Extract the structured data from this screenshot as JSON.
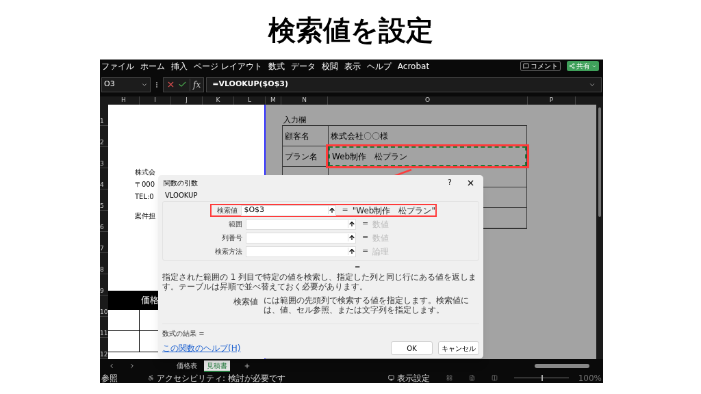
{
  "title": "検索値を設定",
  "menu": [
    {
      "label": "ファイル"
    },
    {
      "label": "ホーム"
    },
    {
      "label": "挿入"
    },
    {
      "label": "ページ レイアウト"
    },
    {
      "label": "数式"
    },
    {
      "label": "データ"
    },
    {
      "label": "校閲"
    },
    {
      "label": "表示"
    },
    {
      "label": "ヘルプ"
    },
    {
      "label": "Acrobat"
    }
  ],
  "comment_button": "コメント",
  "share_button": "共有",
  "name_box": "O3",
  "function_button": "fx",
  "formula": "=VLOOKUP($O$3)",
  "columns": [
    {
      "label": "H",
      "kind": "page"
    },
    {
      "label": "I",
      "kind": "page"
    },
    {
      "label": "J",
      "kind": "page"
    },
    {
      "label": "K",
      "kind": "page"
    },
    {
      "label": "L",
      "kind": "page"
    },
    {
      "label": "M",
      "kind": "m"
    },
    {
      "label": "N",
      "kind": "n"
    },
    {
      "label": "O",
      "kind": "o"
    },
    {
      "label": "P",
      "kind": "p"
    }
  ],
  "rows": [
    "1",
    "2",
    "3",
    "4",
    "5",
    "6",
    "7",
    "8",
    "9",
    "10",
    "11",
    "12"
  ],
  "page_texts": [
    "株式会",
    "〒000",
    "TEL:0",
    "案件担"
  ],
  "price_header": "価格",
  "input_section": {
    "heading": "入力欄",
    "rows": [
      {
        "label": "顧客名",
        "value": "株式会社〇〇様",
        "selected": false
      },
      {
        "label": "プラン名",
        "value": "Web制作　松プラン",
        "selected": true
      }
    ]
  },
  "dialog": {
    "title": "関数の引数",
    "help": "?",
    "function": "VLOOKUP",
    "arguments": [
      {
        "label": "検索値",
        "value": "$O$3",
        "result": "\"Web制作　松プラン\"",
        "kind": "value",
        "highlighted": true,
        "equals": "="
      },
      {
        "label": "範囲",
        "result": "数値",
        "kind": "hint",
        "highlighted": false,
        "equals": "="
      },
      {
        "label": "列番号",
        "result": "数値",
        "kind": "hint",
        "highlighted": false,
        "equals": "="
      },
      {
        "label": "検索方法",
        "result": "論理",
        "kind": "hint",
        "highlighted": false,
        "equals": "="
      }
    ],
    "total_equals": "=",
    "description": "指定された範囲の 1 列目で特定の値を検索し、指定した列と同じ行にある値を返します。テーブルは昇順で並べ替えておく必要があります。",
    "arg_name": "検索値",
    "arg_help": "には範囲の先頭列で検索する値を指定します。検索値には、値、セル参照、または文字列を指定します。",
    "result_label": "数式の結果 =",
    "help_link": "この関数のヘルプ(H)",
    "ok": "OK",
    "cancel": "キャンセル"
  },
  "sheet_tabs": [
    {
      "label": "価格表",
      "selected": false
    },
    {
      "label": "見積書",
      "selected": true
    }
  ],
  "status_bar": {
    "mode": "参照",
    "accessibility": "アクセシビリティ: 検討が必要です",
    "display_settings": "表示設定",
    "zoom": "100%",
    "zoom_slider": {
      "level": 0.5
    }
  }
}
